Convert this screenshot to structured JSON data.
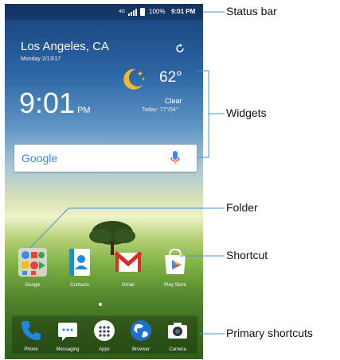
{
  "status_bar": {
    "network": "4G",
    "battery": "100%",
    "time": "9:01 PM"
  },
  "weather_widget": {
    "city": "Los Angeles, CA",
    "date": "Monday 2/13/17",
    "time": "9:01",
    "ampm": "PM",
    "temperature": "62°",
    "condition": "Clear",
    "hi_lo": "Today: 77°/54°"
  },
  "search_widget": {
    "logo_text": "Google"
  },
  "home_apps": [
    {
      "label": "Google",
      "icon": "google-folder-icon"
    },
    {
      "label": "Contacts",
      "icon": "contacts-icon"
    },
    {
      "label": "Gmail",
      "icon": "gmail-icon"
    },
    {
      "label": "Play Store",
      "icon": "play-store-icon"
    }
  ],
  "dock_apps": [
    {
      "label": "Phone",
      "icon": "phone-icon"
    },
    {
      "label": "Messaging",
      "icon": "messaging-icon"
    },
    {
      "label": "Apps",
      "icon": "apps-icon"
    },
    {
      "label": "Browser",
      "icon": "browser-icon"
    },
    {
      "label": "Camera",
      "icon": "camera-icon"
    }
  ],
  "callouts": {
    "status_bar": "Status  bar",
    "widgets": "Widgets",
    "folder": "Folder",
    "shortcut": "Shortcut",
    "primary_shortcuts": "Primary shortcuts"
  },
  "colors": {
    "callout_line": "#4a90d9",
    "google_blue": "#4285f4",
    "google_red": "#ea4335",
    "google_yellow": "#fbbc05",
    "google_green": "#34a853"
  }
}
